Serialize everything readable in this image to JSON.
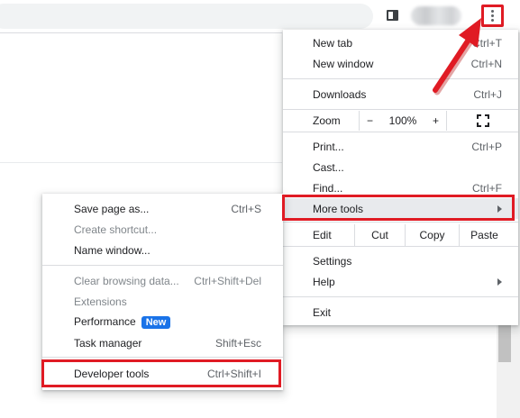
{
  "toolbar": {
    "sidepanel_icon": "side-panel-icon",
    "menu_icon": "kebab-menu-icon"
  },
  "main_menu": {
    "new_tab": {
      "label": "New tab",
      "shortcut": "Ctrl+T"
    },
    "new_window": {
      "label": "New window",
      "shortcut": "Ctrl+N"
    },
    "downloads": {
      "label": "Downloads",
      "shortcut": "Ctrl+J"
    },
    "zoom": {
      "label": "Zoom",
      "minus": "−",
      "value": "100%",
      "plus": "+"
    },
    "print": {
      "label": "Print...",
      "shortcut": "Ctrl+P"
    },
    "cast": {
      "label": "Cast..."
    },
    "find": {
      "label": "Find...",
      "shortcut": "Ctrl+F"
    },
    "more_tools": {
      "label": "More tools"
    },
    "edit": {
      "label": "Edit",
      "cut": "Cut",
      "copy": "Copy",
      "paste": "Paste"
    },
    "settings": {
      "label": "Settings"
    },
    "help": {
      "label": "Help"
    },
    "exit": {
      "label": "Exit"
    }
  },
  "sub_menu": {
    "save_page": {
      "label": "Save page as...",
      "shortcut": "Ctrl+S"
    },
    "create_shortcut": {
      "label": "Create shortcut..."
    },
    "name_window": {
      "label": "Name window..."
    },
    "clear_browsing": {
      "label": "Clear browsing data...",
      "shortcut": "Ctrl+Shift+Del"
    },
    "extensions": {
      "label": "Extensions"
    },
    "performance": {
      "label": "Performance",
      "badge": "New"
    },
    "task_manager": {
      "label": "Task manager",
      "shortcut": "Shift+Esc"
    },
    "developer_tools": {
      "label": "Developer tools",
      "shortcut": "Ctrl+Shift+I"
    }
  },
  "colors": {
    "annotation_red": "#e01b24",
    "badge_blue": "#1a73e8",
    "hover_gray": "#e8eaed"
  }
}
